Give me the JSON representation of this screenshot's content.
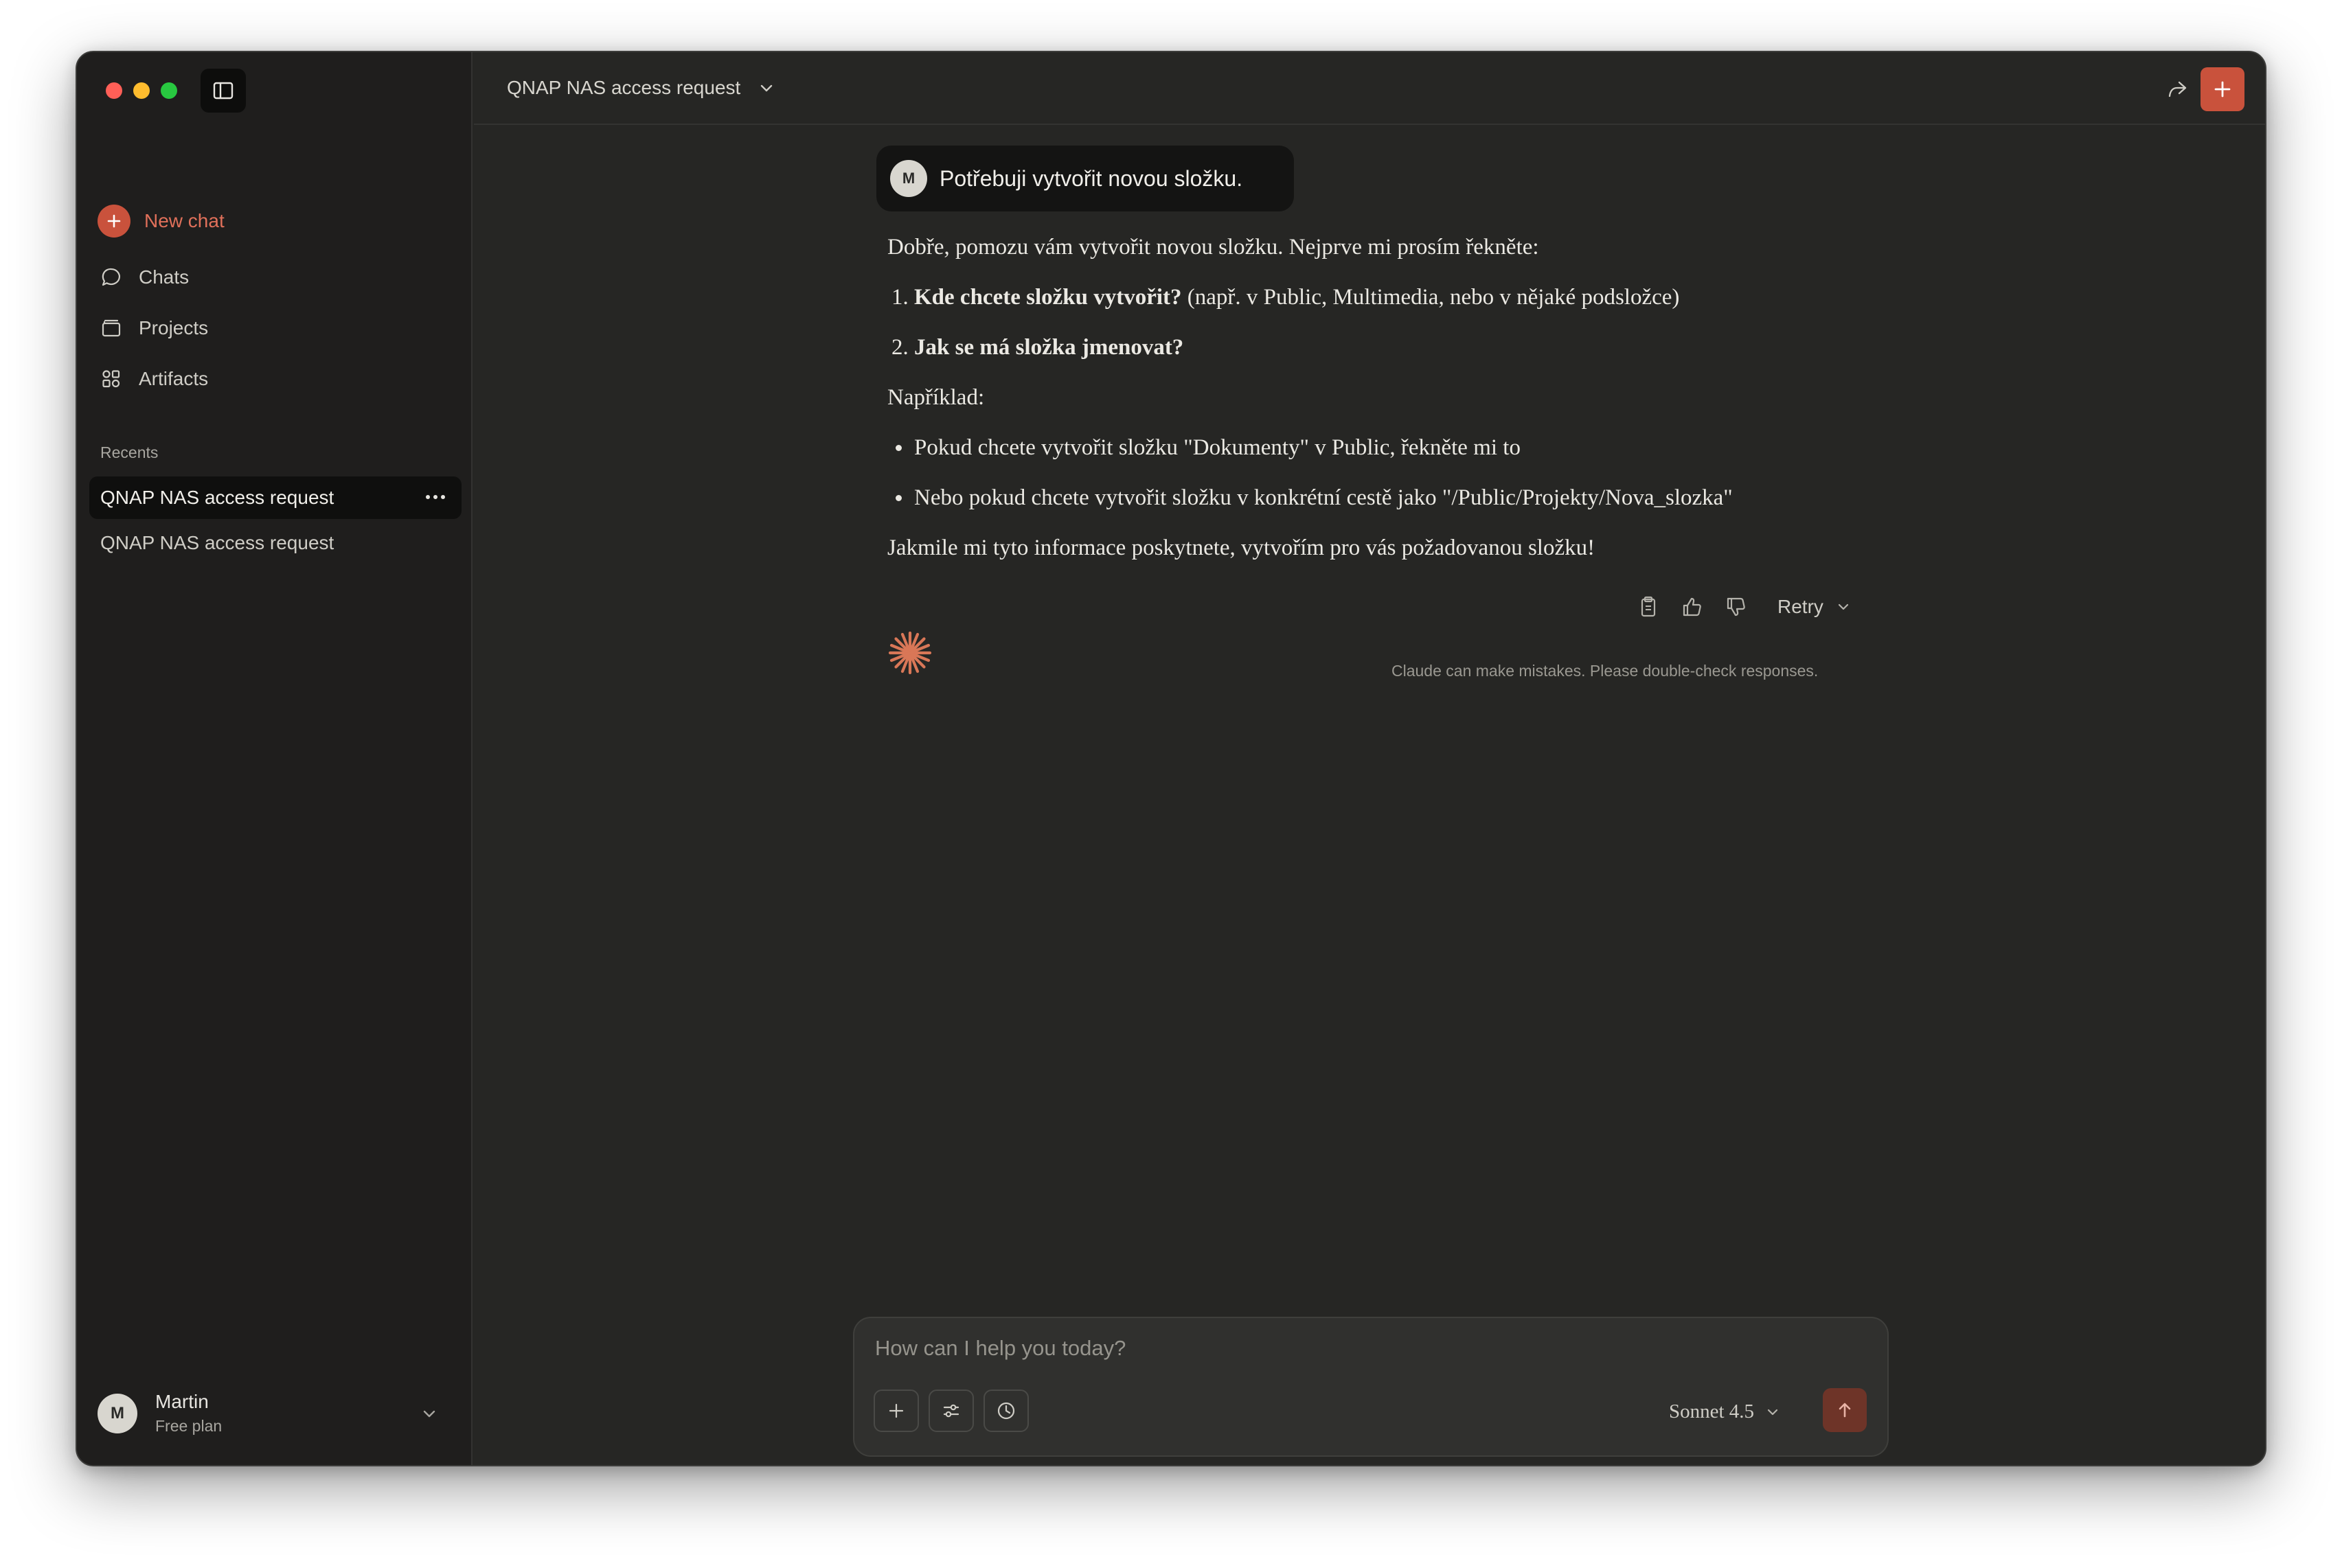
{
  "sidebar": {
    "new_chat_label": "New chat",
    "nav": [
      {
        "label": "Chats",
        "icon": "chat-bubble-icon"
      },
      {
        "label": "Projects",
        "icon": "folder-icon"
      },
      {
        "label": "Artifacts",
        "icon": "artifacts-grid-icon"
      }
    ],
    "recents_label": "Recents",
    "recents": [
      {
        "label": "QNAP NAS access request",
        "active": true
      },
      {
        "label": "QNAP NAS access request",
        "active": false
      }
    ],
    "user": {
      "initial": "M",
      "name": "Martin",
      "plan": "Free plan"
    }
  },
  "header": {
    "chat_title": "QNAP NAS access request"
  },
  "conversation": {
    "user_message": {
      "initial": "M",
      "text": "Potřebuji vytvořit novou složku."
    },
    "assistant": {
      "intro": "Dobře, pomozu vám vytvořit novou složku. Nejprve mi prosím řekněte:",
      "numbered": [
        {
          "num": "1.",
          "bold": "Kde chcete složku vytvořit?",
          "rest": " (např. v Public, Multimedia, nebo v nějaké podsložce)"
        },
        {
          "num": "2.",
          "bold": "Jak se má složka jmenovat?",
          "rest": ""
        }
      ],
      "example_label": "Například:",
      "bullets": [
        "Pokud chcete vytvořit složku \"Dokumenty\" v Public, řekněte mi to",
        "Nebo pokud chcete vytvořit složku v konkrétní cestě jako \"/Public/Projekty/Nova_slozka\""
      ],
      "closing": "Jakmile mi tyto informace poskytnete, vytvořím pro vás požadovanou složku!"
    },
    "actions": {
      "retry_label": "Retry"
    },
    "disclaimer": "Claude can make mistakes. Please double-check responses."
  },
  "composer": {
    "placeholder": "How can I help you today?",
    "model": "Sonnet 4.5"
  },
  "colors": {
    "accent": "#c9523c",
    "window_bg": "#262624",
    "sidebar_bg": "#1f1e1d"
  }
}
